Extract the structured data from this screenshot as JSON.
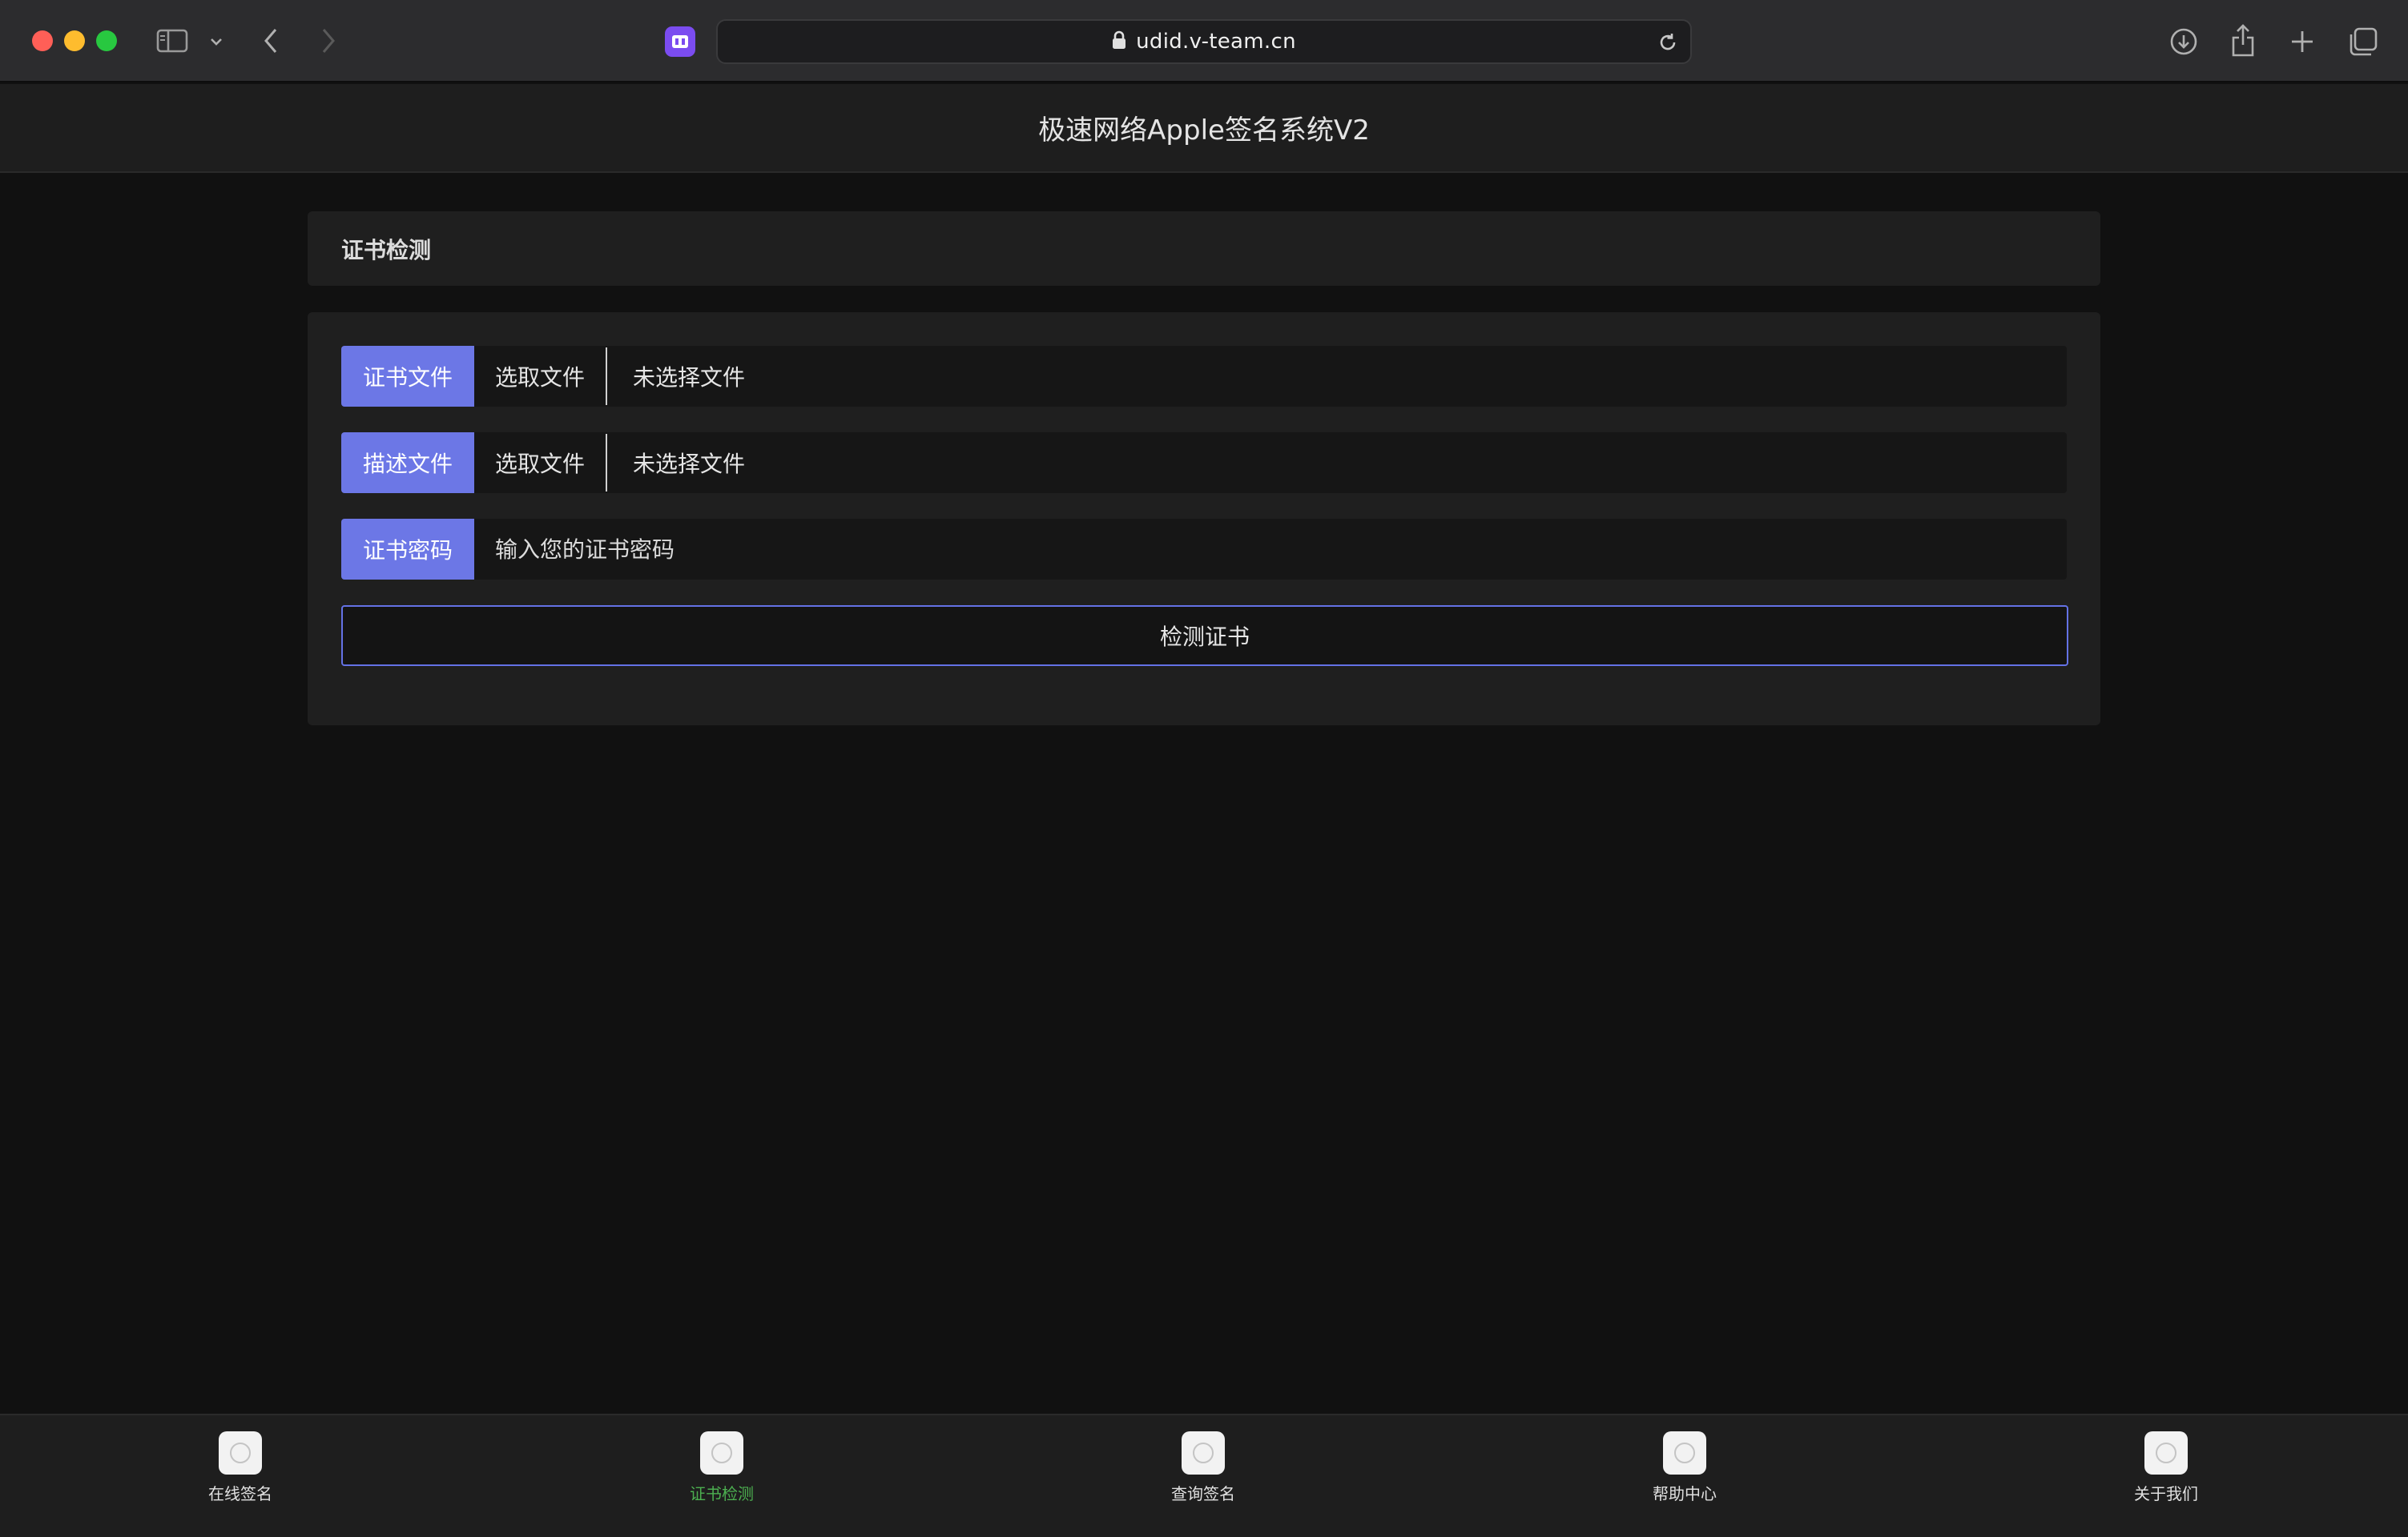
{
  "browser": {
    "url": "udid.v-team.cn"
  },
  "header": {
    "title": "极速网络Apple签名系统V2"
  },
  "section": {
    "title": "证书检测"
  },
  "form": {
    "cert_file": {
      "label": "证书文件",
      "button": "选取文件",
      "status": "未选择文件"
    },
    "profile_file": {
      "label": "描述文件",
      "button": "选取文件",
      "status": "未选择文件"
    },
    "password": {
      "label": "证书密码",
      "placeholder": "输入您的证书密码"
    },
    "submit_label": "检测证书"
  },
  "tabbar": {
    "active_color": "#4caf50",
    "accent_color": "#6c77e6",
    "items": [
      {
        "label": "在线签名",
        "icon": "circle-icon"
      },
      {
        "label": "证书检测",
        "icon": "circle-icon",
        "active": true
      },
      {
        "label": "查询签名",
        "icon": "circle-icon"
      },
      {
        "label": "帮助中心",
        "icon": "circle-icon"
      },
      {
        "label": "关于我们",
        "icon": "circle-icon"
      }
    ]
  }
}
